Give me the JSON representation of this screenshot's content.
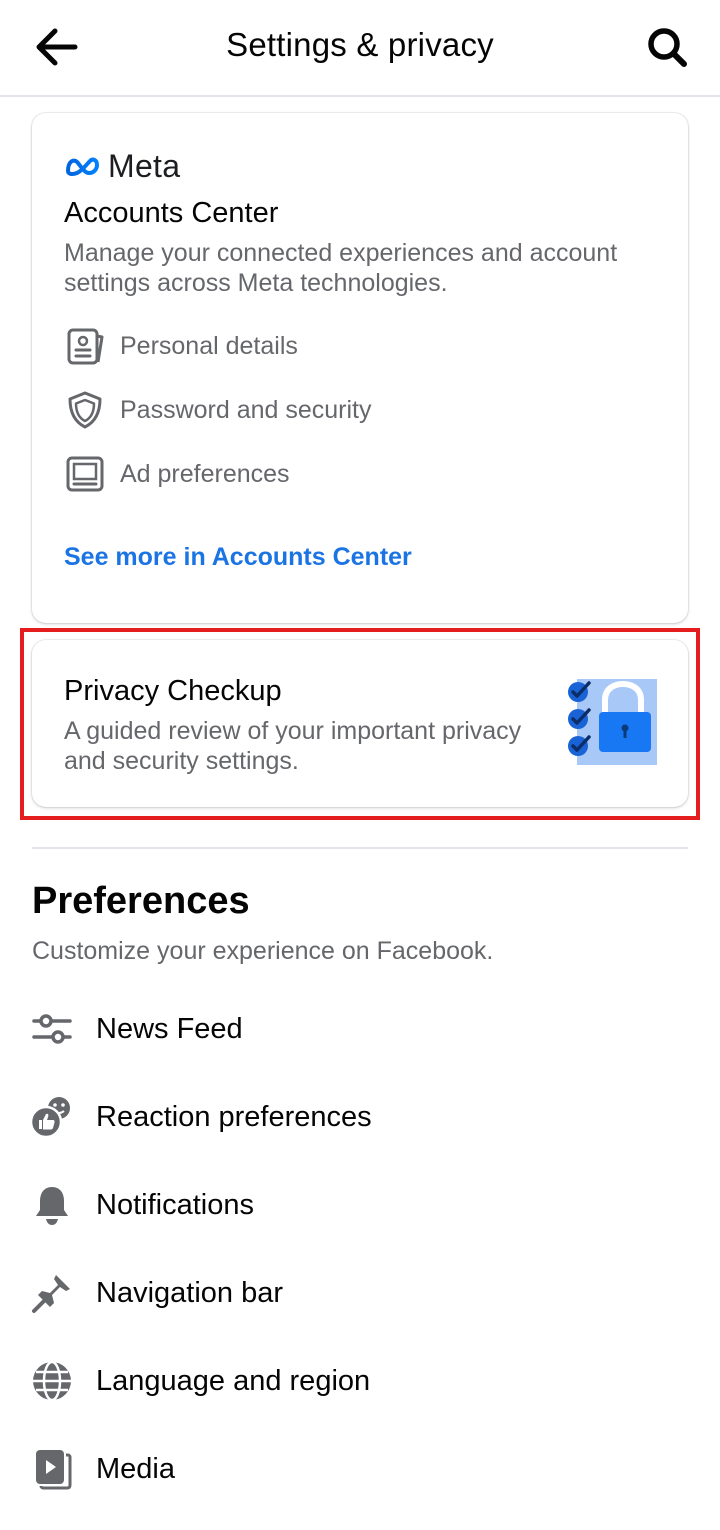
{
  "header": {
    "title": "Settings & privacy",
    "back_icon": "arrow-left-icon",
    "search_icon": "search-icon"
  },
  "accounts_center": {
    "brand": "Meta",
    "title": "Accounts Center",
    "description": "Manage your connected experiences and account settings across Meta technologies.",
    "items": [
      {
        "label": "Personal details",
        "icon": "id-card-icon"
      },
      {
        "label": "Password and security",
        "icon": "shield-icon"
      },
      {
        "label": "Ad preferences",
        "icon": "monitor-icon"
      }
    ],
    "link": "See more in Accounts Center"
  },
  "privacy_checkup": {
    "title": "Privacy Checkup",
    "description": "A guided review of your important privacy and security settings.",
    "illustration": "lock-checklist-icon"
  },
  "preferences": {
    "title": "Preferences",
    "subtitle": "Customize your experience on Facebook.",
    "items": [
      {
        "label": "News Feed",
        "icon": "sliders-icon"
      },
      {
        "label": "Reaction preferences",
        "icon": "reactions-icon"
      },
      {
        "label": "Notifications",
        "icon": "bell-icon"
      },
      {
        "label": "Navigation bar",
        "icon": "pin-icon"
      },
      {
        "label": "Language and region",
        "icon": "globe-icon"
      },
      {
        "label": "Media",
        "icon": "media-icon"
      }
    ]
  },
  "colors": {
    "link_blue": "#1b74e4",
    "highlight_red": "#e41e1f",
    "secondary_text": "#65676b",
    "icon_gray": "#65676b"
  }
}
